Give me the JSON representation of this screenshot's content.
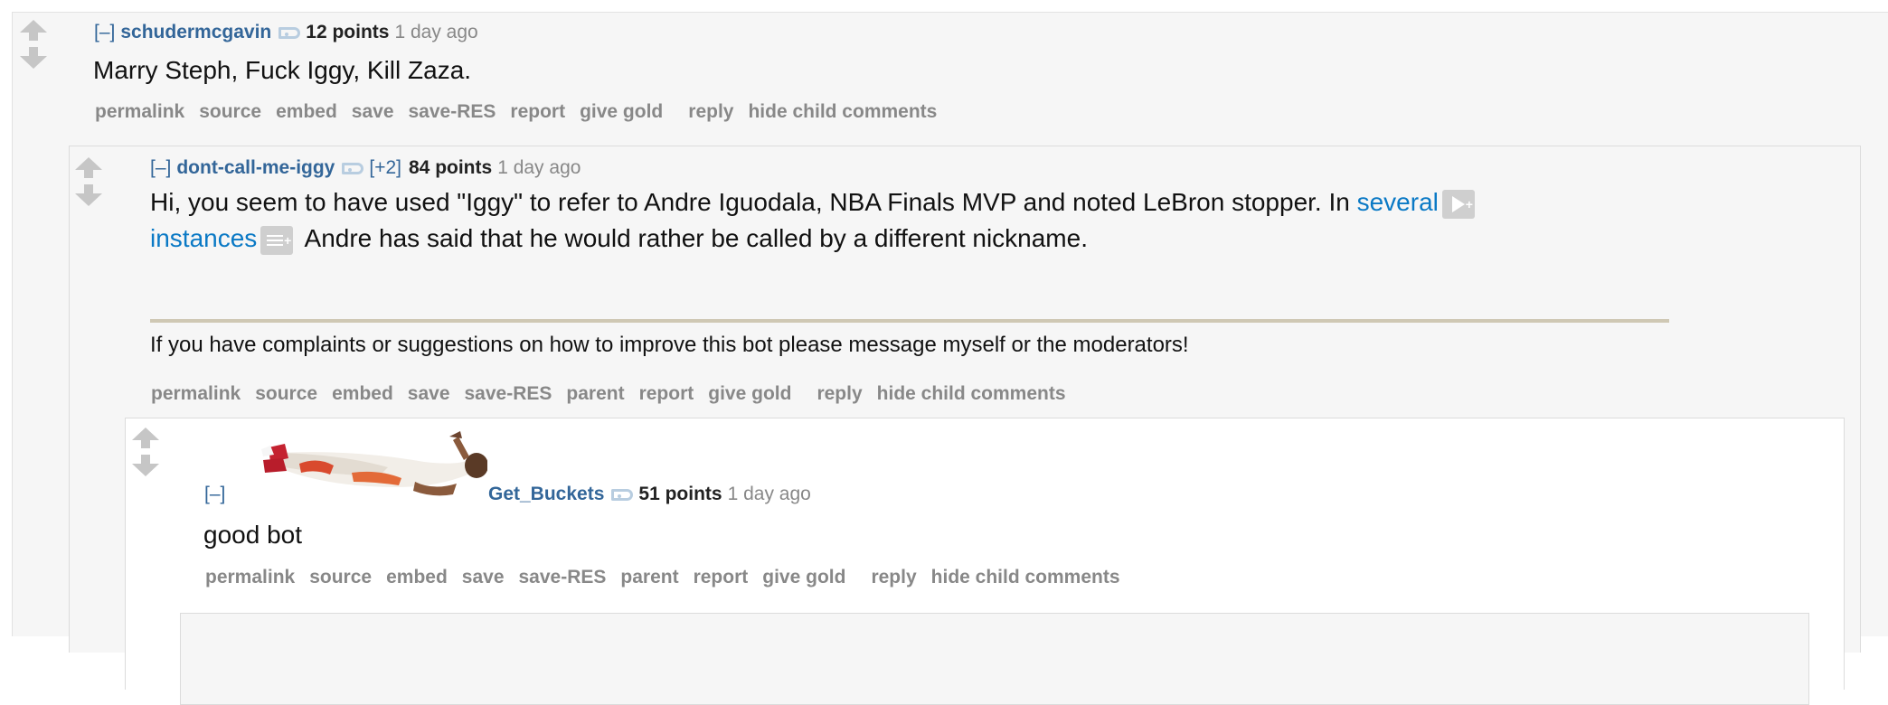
{
  "comments": [
    {
      "expand": "[–]",
      "author": "schudermcgavin",
      "score": "12 points",
      "time": "1 day ago",
      "body": "Marry Steph, Fuck Iggy, Kill Zaza.",
      "buttons": [
        "permalink",
        "source",
        "embed",
        "save",
        "save-RES",
        "report",
        "give gold",
        "reply",
        "hide child comments"
      ]
    },
    {
      "expand": "[–]",
      "author": "dont-call-me-iggy",
      "plus": "[+2]",
      "score": "84 points",
      "time": "1 day ago",
      "body_pre": "Hi, you seem to have used \"Iggy\" to refer to Andre Iguodala, NBA Finals MVP and noted LeBron stopper. In ",
      "link1": "several",
      "link2": "instances",
      "body_post": " Andre has said that he would rather be called by a different nickname.",
      "footnote": "If you have complaints or suggestions on how to improve this bot please message myself or the moderators!",
      "buttons": [
        "permalink",
        "source",
        "embed",
        "save",
        "save-RES",
        "parent",
        "report",
        "give gold",
        "reply",
        "hide child comments"
      ]
    },
    {
      "expand": "[–]",
      "author": "Get_Buckets",
      "score": "51 points",
      "time": "1 day ago",
      "body": "good bot",
      "buttons": [
        "permalink",
        "source",
        "embed",
        "save",
        "save-RES",
        "parent",
        "report",
        "give gold",
        "reply",
        "hide child comments"
      ]
    }
  ],
  "icons": {
    "upvote": "upvote-arrow-icon",
    "downvote": "downvote-arrow-icon",
    "tag": "user-tag-icon",
    "play": "res-expando-play-icon",
    "text": "res-expando-text-icon"
  },
  "colors": {
    "author": "#336699",
    "link": "#0a79c5",
    "button": "#888888",
    "divider": "#cfc8b4"
  }
}
